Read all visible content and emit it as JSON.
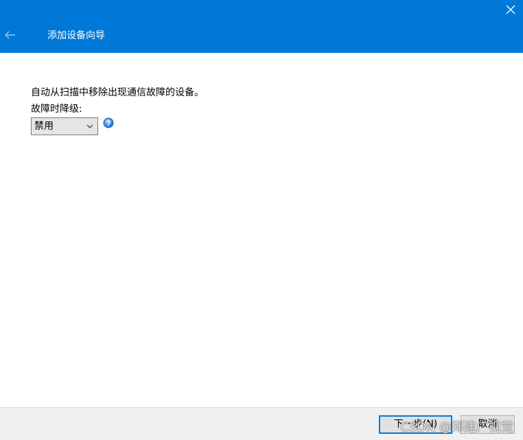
{
  "titlebar": {
    "title": "添加设备向导",
    "close_icon": "close-icon",
    "back_icon": "back-arrow-icon"
  },
  "content": {
    "description": "自动从扫描中移除出现通信故障的设备。",
    "degrade_label": "故障时降级:",
    "degrade_select": {
      "selected": "禁用"
    },
    "help_icon": "help-question-icon"
  },
  "footer": {
    "next_label": "下一步(N)",
    "cancel_label": "取消"
  },
  "watermark": "CSDN @郑建广视觉",
  "colors": {
    "accent": "#0078d7",
    "footer_bg": "#f0f0f0",
    "button_bg": "#e1e1e1"
  }
}
